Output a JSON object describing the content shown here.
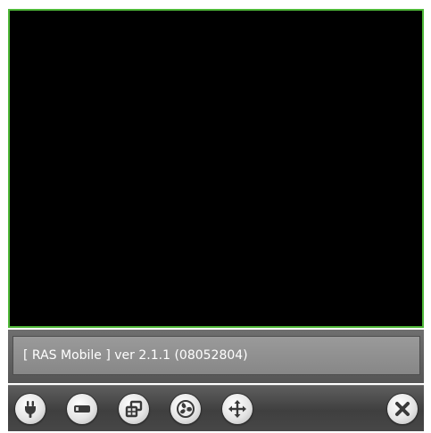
{
  "status": {
    "text": "[ RAS Mobile ] ver 2.1.1 (08052804)"
  },
  "toolbar": {
    "buttons": [
      {
        "icon": "plug-icon"
      },
      {
        "icon": "minus-bar-icon"
      },
      {
        "icon": "windows-icon"
      },
      {
        "icon": "fan-icon"
      },
      {
        "icon": "move-icon"
      },
      {
        "icon": "close-icon"
      }
    ]
  },
  "colors": {
    "frame_border": "#4fb839",
    "video_background": "#000000",
    "icon": "#3a3a3a"
  }
}
